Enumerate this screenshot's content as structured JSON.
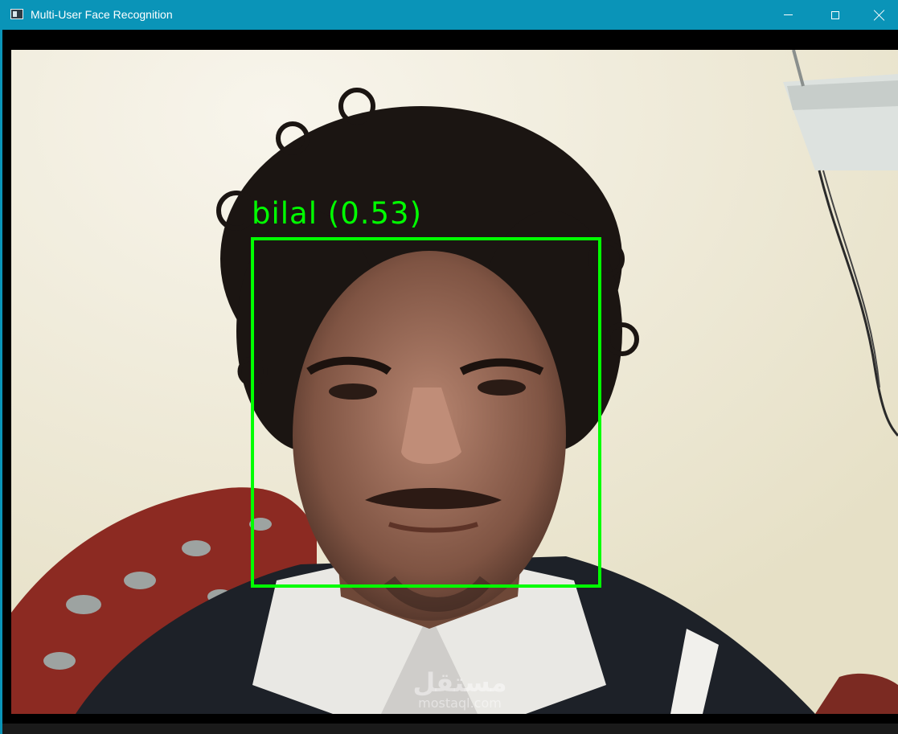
{
  "window": {
    "title": "Multi-User Face Recognition",
    "controls": {
      "minimize": "minimize",
      "maximize": "maximize",
      "close": "close"
    },
    "accent_color": "#0a94b8"
  },
  "video": {
    "detections": [
      {
        "name": "bilal",
        "confidence": "0.53",
        "label": "bilal (0.53)",
        "box_color": "#00ff00"
      }
    ],
    "watermark": {
      "arabic": "مستقل",
      "latin": "mostaql.com"
    }
  }
}
